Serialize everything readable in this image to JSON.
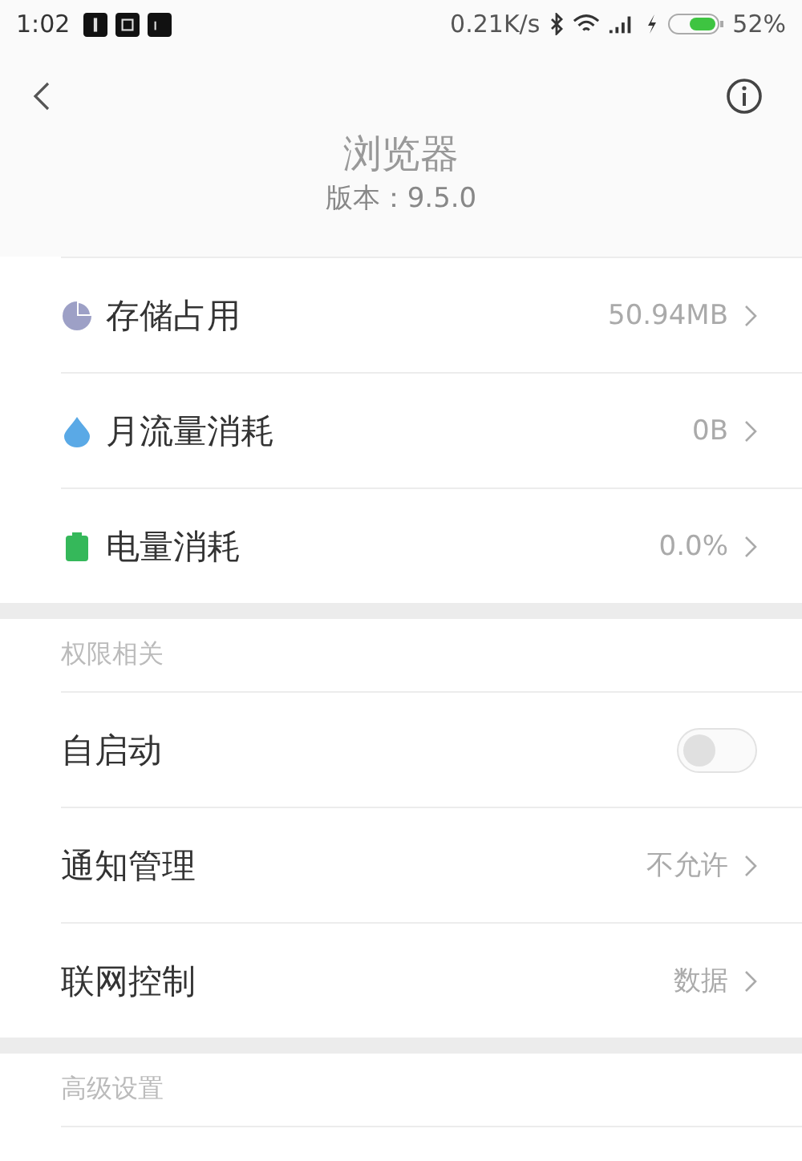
{
  "status_bar": {
    "time": "1:02",
    "speed": "0.21K/s",
    "battery": "52%"
  },
  "header": {
    "title": "浏览器",
    "version": "版本：9.5.0"
  },
  "sections": [
    {
      "rows": [
        {
          "kind": "usage",
          "label": "存储占用",
          "value": "50.94MB"
        },
        {
          "kind": "usage",
          "label": "月流量消耗",
          "value": "0B"
        },
        {
          "kind": "usage",
          "label": "电量消耗",
          "value": "0.0%"
        }
      ]
    },
    {
      "title": "权限相关",
      "rows": [
        {
          "kind": "toggle",
          "label": "自启动",
          "on": false
        },
        {
          "kind": "link",
          "label": "通知管理",
          "value": "不允许"
        },
        {
          "kind": "link",
          "label": "联网控制",
          "value": "数据"
        }
      ]
    },
    {
      "title": "高级设置"
    }
  ]
}
